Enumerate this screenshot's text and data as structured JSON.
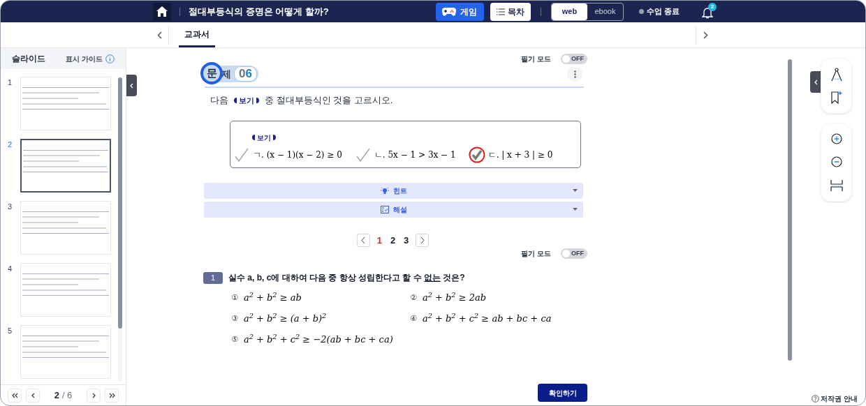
{
  "header": {
    "title": "절대부등식의 증명은 어떻게 할까?",
    "game_button": "게임",
    "toc_button": "목차",
    "view_modes": [
      {
        "label": "web",
        "selected": true
      },
      {
        "label": "ebook",
        "selected": false
      }
    ],
    "end_class": "수업 종료",
    "notification_count": "2"
  },
  "tabs": [
    {
      "label": "교과서",
      "selected": true
    }
  ],
  "sidebar": {
    "title": "슬라이드",
    "guide": "표시 가이드",
    "slides": [
      {
        "number": "1",
        "selected": false
      },
      {
        "number": "2",
        "selected": true
      },
      {
        "number": "3",
        "selected": false
      },
      {
        "number": "4",
        "selected": false
      },
      {
        "number": "5",
        "selected": false
      }
    ],
    "pager": {
      "current": "2",
      "total": "/ 6"
    }
  },
  "pen_modes": [
    {
      "label": "필기 모드",
      "on": false,
      "state_text": "OFF"
    },
    {
      "label": "필기 모드",
      "on": false,
      "state_text": "OFF"
    }
  ],
  "problem": {
    "badge_1": "문",
    "badge_2": "제",
    "number": "06",
    "instruction_before": "다음",
    "instruction_tag": "보기",
    "instruction_after": "중 절대부등식인 것을 고르시오.",
    "box_tag": "보기",
    "items": [
      {
        "text": "ㄱ. (x − 1)(x − 2) ≥ 0",
        "checked": false
      },
      {
        "text": "ㄴ. 5x − 1 > 3x − 1",
        "checked": false
      },
      {
        "text": "ㄷ. | x + 3 | ≥ 0",
        "checked": true
      }
    ]
  },
  "accordions": [
    {
      "kind": "hint",
      "label": "힌트",
      "expanded": false
    },
    {
      "kind": "explanation",
      "label": "해설",
      "expanded": false
    }
  ],
  "pagination": [
    {
      "label": "1",
      "selected": true
    },
    {
      "label": "2",
      "selected": false
    },
    {
      "label": "3",
      "selected": false
    }
  ],
  "question": {
    "number": "1",
    "text_before": "실수 a, b, c에 대하여 다음 중 항상 성립한다고 할 수 ",
    "text_underlined": "없는",
    "text_after": " 것은?",
    "options": [
      {
        "marker": "①",
        "text": "a$^{2}$ + b$^{2}$ ≥ ab"
      },
      {
        "marker": "②",
        "text": "a$^{2}$ + b$^{2}$ ≥ 2ab"
      },
      {
        "marker": "③",
        "text": "a$^{2}$ + b$^{2}$ ≥ (a + b)$^{2}$"
      },
      {
        "marker": "④",
        "text": "a$^{2}$ + b$^{2}$ + c$^{2}$ ≥ ab + bc + ca"
      },
      {
        "marker": "⑤",
        "text": "a$^{2}$ + b$^{2}$ + c$^{2}$ ≥ −2(ab + bc + ca)"
      }
    ]
  },
  "confirm_button": "확인하기",
  "copyright": "저작권 안내"
}
